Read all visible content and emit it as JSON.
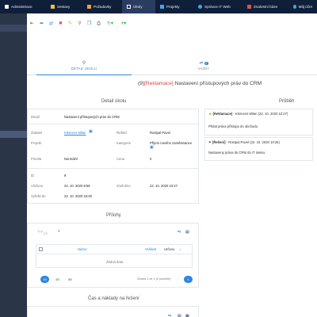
{
  "topnav": {
    "items": [
      {
        "label": "Administrace",
        "icon": "admin-icon",
        "color": "#ffffff"
      },
      {
        "label": "Sestavy",
        "icon": "report-icon",
        "color": "#f0c040"
      },
      {
        "label": "Požadavky",
        "icon": "request-icon",
        "color": "#f0a030"
      },
      {
        "label": "Úkoly",
        "icon": "tasks-icon",
        "color": "#ffffff"
      },
      {
        "label": "Projekty",
        "icon": "projects-icon",
        "color": "#4aa3e8"
      },
      {
        "label": "Správce IT Web",
        "icon": "web-icon",
        "color": "#4aa3e8"
      },
      {
        "label": "Znalostní báze",
        "icon": "knowledge-icon",
        "color": "#e05050"
      },
      {
        "label": "Můj účet",
        "icon": "user-icon",
        "color": "#4aa3e8"
      }
    ]
  },
  "tabs": {
    "detail": {
      "label": "DETAIL ÚKOLU",
      "icon": "search-icon"
    },
    "vazby": {
      "label": "VAZBY",
      "icon": "link-icon",
      "badge": "1"
    }
  },
  "task": {
    "number": "(9)",
    "tag": "[Reklamace]",
    "name": "Nastavení přístupových práv do CRM"
  },
  "detail": {
    "heading": "Detail úkolu",
    "fields": {
      "detail_label": "Detail",
      "detail_value": "Nastavení přístupových práv do CRM",
      "zadatel_label": "Žadatel",
      "zadatel_value": "Klemens Milan",
      "resitel_label": "Řešitel",
      "resitel_value": "Rostpal Pavel",
      "projekt_label": "Projekt",
      "kategorie_label": "Kategorie",
      "kategorie_value": "Příjem nového zaměstnance",
      "priorita_label": "Priorita",
      "priorita_value": "Normální",
      "cena_label": "Cena",
      "cena_value": "0",
      "id_label": "ID",
      "id_value": "9",
      "vlozeno_label": "Vloženo",
      "vlozeno_value": "22. 10. 2020 8:59",
      "zmeneno_label": "Změněno",
      "zmeneno_value": "22. 10. 2020 10:27",
      "vyresit_label": "Vyřešit do",
      "vyresit_value": "22. 10. 2020 15:30"
    }
  },
  "history": {
    "heading": "Průběh",
    "items": [
      {
        "icon": "smile-icon",
        "tag": "[Reklamace]",
        "meta": " - Klemens Milan (22. 10. 2020 10:27)",
        "text": "Přidat práva přístupu do obchodu."
      },
      {
        "icon": "flag-icon",
        "tag": "[Řešení]",
        "meta": " - Rostpal Pavel (22. 10. 2020 10:25)",
        "text": "Nastaveny práva do CRM do IT úseku."
      }
    ]
  },
  "attachments": {
    "heading": "Přílohy",
    "columns": {
      "name": "Název",
      "size": "Velikost",
      "owner": "Určeno"
    },
    "empty": "Žádná data",
    "page_sizes": [
      "10",
      "20",
      "50"
    ],
    "page_info": "Strana 1 ze 1 (0 položek)",
    "current_page": "1",
    "batch_label": "(0)"
  },
  "costs": {
    "heading": "Čas a náklady na řešení"
  },
  "colors": {
    "accent": "#2e86de",
    "topnav_bg": "#0f1f3a",
    "sidebar_bg": "#2b3548",
    "tag_red": "#d64545"
  }
}
